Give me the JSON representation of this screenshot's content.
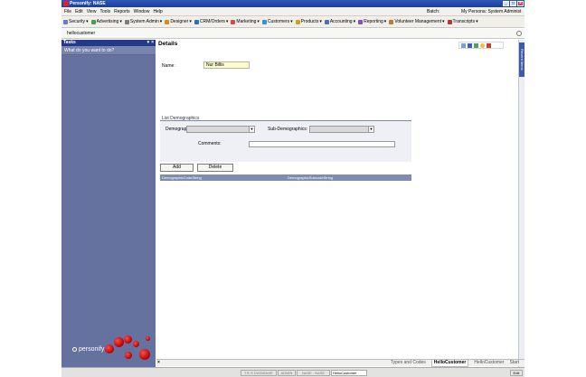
{
  "window": {
    "title": "Personify: NASE"
  },
  "menubar": {
    "items": [
      "File",
      "Edit",
      "View",
      "Tools",
      "Reports",
      "Window",
      "Help"
    ],
    "batch_label": "Batch:",
    "persona_label": "My Persona: System Administ"
  },
  "toolbar": {
    "items": [
      {
        "label": "Security",
        "color": "#5a7fd0"
      },
      {
        "label": "Advertising",
        "color": "#4aa04a"
      },
      {
        "label": "System Admin",
        "color": "#7d7d7d"
      },
      {
        "label": "Designer",
        "color": "#d98a1f"
      },
      {
        "label": "CRM/Orders",
        "color": "#2a6bc5"
      },
      {
        "label": "Marketing",
        "color": "#d24a4a"
      },
      {
        "label": "Customers",
        "color": "#3a8fd0"
      },
      {
        "label": "Products",
        "color": "#c9a21a"
      },
      {
        "label": "Accounting",
        "color": "#4a70c0"
      },
      {
        "label": "Reporting",
        "color": "#8a4ac0"
      },
      {
        "label": "Volunteer Management",
        "color": "#c07a30"
      },
      {
        "label": "Transcripts",
        "color": "#b03a3a"
      }
    ]
  },
  "tab": {
    "name": "hellocustomer"
  },
  "tasks": {
    "header": "Tasks",
    "prompt": "What do you want to do?",
    "logo_text": "personify"
  },
  "details": {
    "title": "Details",
    "name_label": "Name:",
    "name_value": "Nur Billis",
    "list_demographics_title": "List Demographics",
    "demographics_label": "Demographics:",
    "subdemographics_label": "Sub-Demographics:",
    "comments_label": "Comments:",
    "add_button": "Add",
    "delete_button": "Delete",
    "grid_columns": [
      "DemographicCodeString",
      "DemographicSubcodeString"
    ]
  },
  "rightrail": {
    "tab_label": "Recent Items"
  },
  "bottom_tabs": {
    "close_glyph": "×",
    "tabs": [
      {
        "label": "Types and Codes",
        "active": false
      },
      {
        "label": "HelloCustomer",
        "active": true
      },
      {
        "label": "HelloCustomer",
        "active": false
      },
      {
        "label": "Start",
        "active": false
      }
    ]
  },
  "statusbar": {
    "segments": [
      "T.E.S DATABASE",
      "ADMIN",
      "NASE : NASE",
      "HelloCustomer"
    ],
    "mode": "Edit"
  }
}
